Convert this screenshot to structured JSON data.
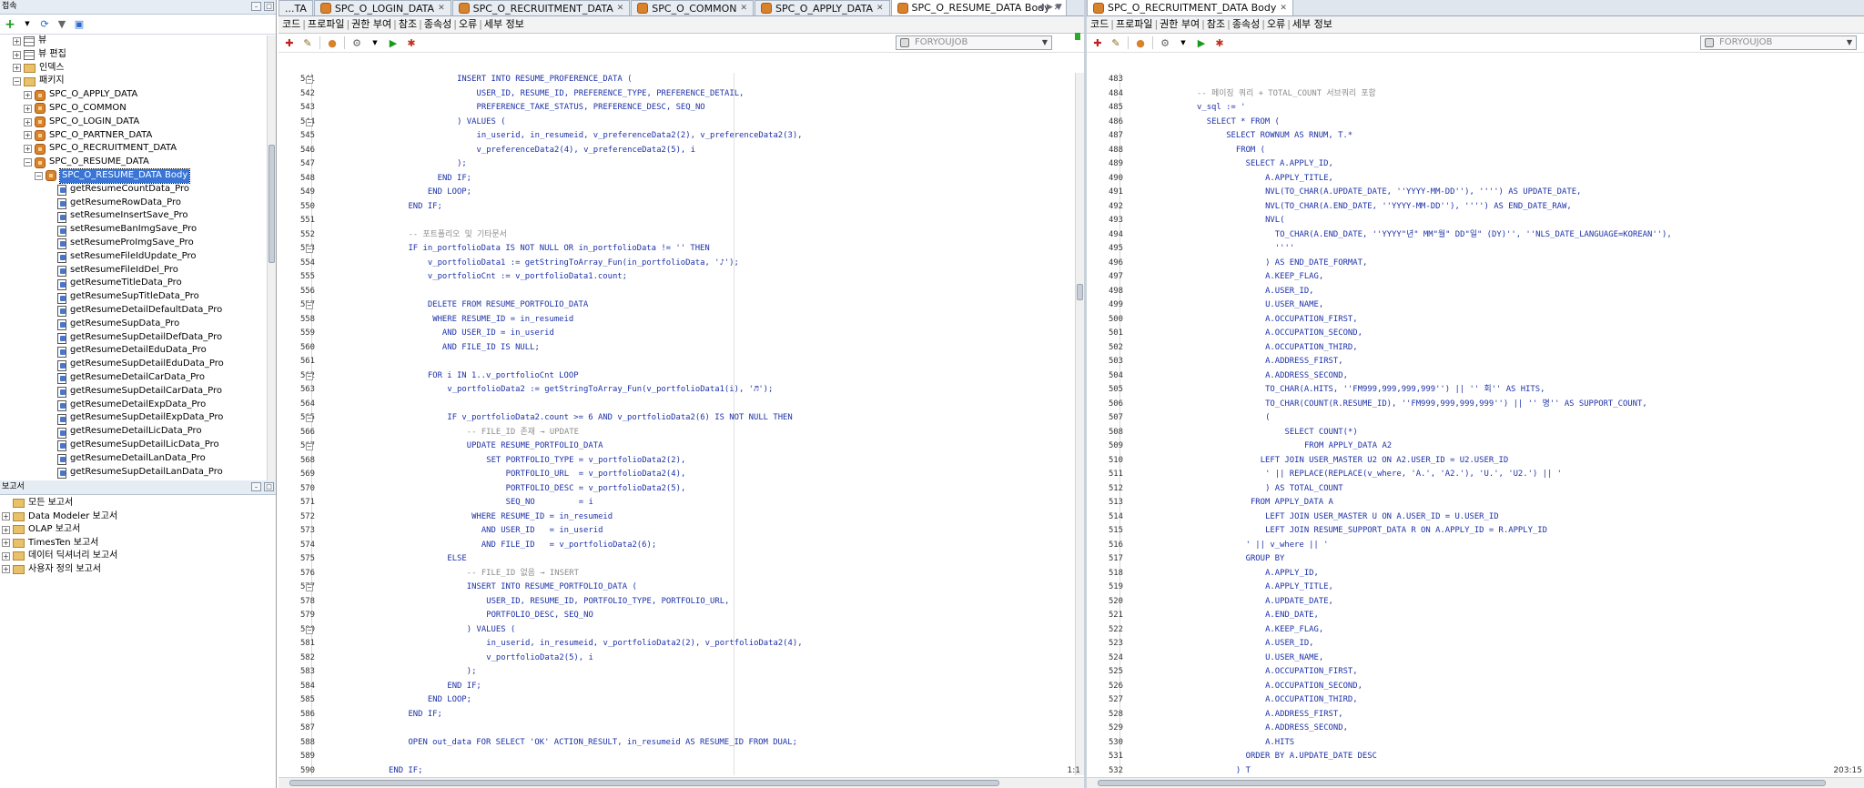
{
  "navigator": {
    "title": "접속",
    "tree": [
      {
        "label": "뷰",
        "kind": "grid",
        "indent": 1,
        "expander": "+"
      },
      {
        "label": "뷰 편집",
        "kind": "grid",
        "indent": 1,
        "expander": "+"
      },
      {
        "label": "인덱스",
        "kind": "folder",
        "indent": 1,
        "expander": "+"
      },
      {
        "label": "패키지",
        "kind": "folder",
        "indent": 1,
        "expander": "-"
      },
      {
        "label": "SPC_O_APPLY_DATA",
        "kind": "package",
        "indent": 2,
        "expander": "+"
      },
      {
        "label": "SPC_O_COMMON",
        "kind": "package",
        "indent": 2,
        "expander": "+"
      },
      {
        "label": "SPC_O_LOGIN_DATA",
        "kind": "package",
        "indent": 2,
        "expander": "+"
      },
      {
        "label": "SPC_O_PARTNER_DATA",
        "kind": "package",
        "indent": 2,
        "expander": "+"
      },
      {
        "label": "SPC_O_RECRUITMENT_DATA",
        "kind": "package",
        "indent": 2,
        "expander": "+"
      },
      {
        "label": "SPC_O_RESUME_DATA",
        "kind": "package",
        "indent": 2,
        "expander": "-"
      },
      {
        "label": "SPC_O_RESUME_DATA Body",
        "kind": "package",
        "indent": 3,
        "expander": "-",
        "selected": true
      },
      {
        "label": "getResumeCountData_Pro",
        "kind": "proc",
        "indent": 4
      },
      {
        "label": "getResumeRowData_Pro",
        "kind": "proc",
        "indent": 4
      },
      {
        "label": "setResumeInsertSave_Pro",
        "kind": "proc",
        "indent": 4
      },
      {
        "label": "setResumeBanImgSave_Pro",
        "kind": "proc",
        "indent": 4
      },
      {
        "label": "setResumeProImgSave_Pro",
        "kind": "proc",
        "indent": 4
      },
      {
        "label": "setResumeFileIdUpdate_Pro",
        "kind": "proc",
        "indent": 4
      },
      {
        "label": "setResumeFileIdDel_Pro",
        "kind": "proc",
        "indent": 4
      },
      {
        "label": "getResumeTitleData_Pro",
        "kind": "proc",
        "indent": 4
      },
      {
        "label": "getResumeSupTitleData_Pro",
        "kind": "proc",
        "indent": 4
      },
      {
        "label": "getResumeDetailDefaultData_Pro",
        "kind": "proc",
        "indent": 4
      },
      {
        "label": "getResumeSupData_Pro",
        "kind": "proc",
        "indent": 4
      },
      {
        "label": "getResumeSupDetailDefData_Pro",
        "kind": "proc",
        "indent": 4
      },
      {
        "label": "getResumeDetailEduData_Pro",
        "kind": "proc",
        "indent": 4
      },
      {
        "label": "getResumeSupDetailEduData_Pro",
        "kind": "proc",
        "indent": 4
      },
      {
        "label": "getResumeDetailCarData_Pro",
        "kind": "proc",
        "indent": 4
      },
      {
        "label": "getResumeSupDetailCarData_Pro",
        "kind": "proc",
        "indent": 4
      },
      {
        "label": "getResumeDetailExpData_Pro",
        "kind": "proc",
        "indent": 4
      },
      {
        "label": "getResumeSupDetailExpData_Pro",
        "kind": "proc",
        "indent": 4
      },
      {
        "label": "getResumeDetailLicData_Pro",
        "kind": "proc",
        "indent": 4
      },
      {
        "label": "getResumeSupDetailLicData_Pro",
        "kind": "proc",
        "indent": 4
      },
      {
        "label": "getResumeDetailLanData_Pro",
        "kind": "proc",
        "indent": 4
      },
      {
        "label": "getResumeSupDetailLanData_Pro",
        "kind": "proc",
        "indent": 4
      }
    ]
  },
  "reports": {
    "title": "보고서",
    "items": [
      {
        "label": "모든 보고서",
        "expander": ""
      },
      {
        "label": "Data Modeler 보고서",
        "expander": "+"
      },
      {
        "label": "OLAP 보고서",
        "expander": "+"
      },
      {
        "label": "TimesTen 보고서",
        "expander": "+"
      },
      {
        "label": "데이터 딕셔너리 보고서",
        "expander": "+"
      },
      {
        "label": "사용자 정의 보고서",
        "expander": "+"
      }
    ]
  },
  "left_tabs": [
    {
      "label": "...TA",
      "active": false
    },
    {
      "label": "SPC_O_LOGIN_DATA",
      "active": false
    },
    {
      "label": "SPC_O_RECRUITMENT_DATA",
      "active": false
    },
    {
      "label": "SPC_O_COMMON",
      "active": false
    },
    {
      "label": "SPC_O_APPLY_DATA",
      "active": false
    },
    {
      "label": "SPC_O_RESUME_DATA Body",
      "active": true
    }
  ],
  "right_tabs": [
    {
      "label": "SPC_O_RECRUITMENT_DATA Body",
      "active": true
    }
  ],
  "subtabs": [
    "코드",
    "프로파일",
    "권한 부여",
    "참조",
    "종속성",
    "오류",
    "세부 정보"
  ],
  "connection": "FORYOUJOB",
  "left_editor": {
    "status": "1:1",
    "lines": [
      {
        "n": "541",
        "i": 14,
        "t": "INSERT INTO RESUME_PROFERENCE_DATA (",
        "f": "-"
      },
      {
        "n": "542",
        "i": 16,
        "t": "USER_ID, RESUME_ID, PREFERENCE_TYPE, PREFERENCE_DETAIL,"
      },
      {
        "n": "543",
        "i": 16,
        "t": "PREFERENCE_TAKE_STATUS, PREFERENCE_DESC, SEQ_NO"
      },
      {
        "n": "544",
        "i": 14,
        "t": ") VALUES (",
        "f": "-"
      },
      {
        "n": "545",
        "i": 16,
        "t": "in_userid, in_resumeid, v_preferenceData2(2), v_preferenceData2(3),"
      },
      {
        "n": "546",
        "i": 16,
        "t": "v_preferenceData2(4), v_preferenceData2(5), i"
      },
      {
        "n": "547",
        "i": 14,
        "t": ");"
      },
      {
        "n": "548",
        "i": 12,
        "t": "END IF;"
      },
      {
        "n": "549",
        "i": 11,
        "t": "END LOOP;"
      },
      {
        "n": "550",
        "i": 9,
        "t": "END IF;"
      },
      {
        "n": "551",
        "i": 0,
        "t": ""
      },
      {
        "n": "552",
        "i": 9,
        "t": "-- 포트폴리오 및 기타문서",
        "c": true
      },
      {
        "n": "553",
        "i": 9,
        "t": "IF in_portfolioData IS NOT NULL OR in_portfolioData != '' THEN",
        "f": "-"
      },
      {
        "n": "554",
        "i": 11,
        "t": "v_portfolioData1 := getStringToArray_Fun(in_portfolioData, '♪');"
      },
      {
        "n": "555",
        "i": 11,
        "t": "v_portfolioCnt := v_portfolioData1.count;"
      },
      {
        "n": "556",
        "i": 0,
        "t": ""
      },
      {
        "n": "557",
        "i": 11,
        "t": "DELETE FROM RESUME_PORTFOLIO_DATA",
        "f": "-"
      },
      {
        "n": "558",
        "i": 11,
        "t": " WHERE RESUME_ID = in_resumeid"
      },
      {
        "n": "559",
        "i": 11,
        "t": "   AND USER_ID = in_userid"
      },
      {
        "n": "560",
        "i": 11,
        "t": "   AND FILE_ID IS NULL;"
      },
      {
        "n": "561",
        "i": 0,
        "t": ""
      },
      {
        "n": "562",
        "i": 11,
        "t": "FOR i IN 1..v_portfolioCnt LOOP",
        "f": "-"
      },
      {
        "n": "563",
        "i": 13,
        "t": "v_portfolioData2 := getStringToArray_Fun(v_portfolioData1(i), '♬');"
      },
      {
        "n": "564",
        "i": 0,
        "t": ""
      },
      {
        "n": "565",
        "i": 13,
        "t": "IF v_portfolioData2.count >= 6 AND v_portfolioData2(6) IS NOT NULL THEN",
        "f": "-"
      },
      {
        "n": "566",
        "i": 15,
        "t": "-- FILE_ID 존재 → UPDATE",
        "c": true
      },
      {
        "n": "567",
        "i": 15,
        "t": "UPDATE RESUME_PORTFOLIO_DATA",
        "f": "-"
      },
      {
        "n": "568",
        "i": 17,
        "t": "SET PORTFOLIO_TYPE = v_portfolioData2(2),"
      },
      {
        "n": "569",
        "i": 17,
        "t": "    PORTFOLIO_URL  = v_portfolioData2(4),"
      },
      {
        "n": "570",
        "i": 17,
        "t": "    PORTFOLIO_DESC = v_portfolioData2(5),"
      },
      {
        "n": "571",
        "i": 17,
        "t": "    SEQ_NO         = i"
      },
      {
        "n": "572",
        "i": 15,
        "t": " WHERE RESUME_ID = in_resumeid"
      },
      {
        "n": "573",
        "i": 15,
        "t": "   AND USER_ID   = in_userid"
      },
      {
        "n": "574",
        "i": 15,
        "t": "   AND FILE_ID   = v_portfolioData2(6);"
      },
      {
        "n": "575",
        "i": 13,
        "t": "ELSE"
      },
      {
        "n": "576",
        "i": 15,
        "t": "-- FILE_ID 없음 → INSERT",
        "c": true
      },
      {
        "n": "577",
        "i": 15,
        "t": "INSERT INTO RESUME_PORTFOLIO_DATA (",
        "f": "-"
      },
      {
        "n": "578",
        "i": 17,
        "t": "USER_ID, RESUME_ID, PORTFOLIO_TYPE, PORTFOLIO_URL,"
      },
      {
        "n": "579",
        "i": 17,
        "t": "PORTFOLIO_DESC, SEQ_NO"
      },
      {
        "n": "580",
        "i": 15,
        "t": ") VALUES (",
        "f": "-"
      },
      {
        "n": "581",
        "i": 17,
        "t": "in_userid, in_resumeid, v_portfolioData2(2), v_portfolioData2(4),"
      },
      {
        "n": "582",
        "i": 17,
        "t": "v_portfolioData2(5), i"
      },
      {
        "n": "583",
        "i": 15,
        "t": ");"
      },
      {
        "n": "584",
        "i": 13,
        "t": "END IF;"
      },
      {
        "n": "585",
        "i": 11,
        "t": "END LOOP;"
      },
      {
        "n": "586",
        "i": 9,
        "t": "END IF;"
      },
      {
        "n": "587",
        "i": 0,
        "t": ""
      },
      {
        "n": "588",
        "i": 9,
        "t": "OPEN out_data FOR SELECT 'OK' ACTION_RESULT, in_resumeid AS RESUME_ID FROM DUAL;"
      },
      {
        "n": "589",
        "i": 0,
        "t": ""
      },
      {
        "n": "590",
        "i": 7,
        "t": "END IF;"
      }
    ]
  },
  "right_editor": {
    "status": "203:15",
    "lines": [
      {
        "n": "483",
        "i": 0,
        "t": ""
      },
      {
        "n": "484",
        "i": 7,
        "t": "-- 페이징 쿼리 + TOTAL_COUNT 서브쿼리 포함",
        "c": true
      },
      {
        "n": "485",
        "i": 7,
        "t": "v_sql := '"
      },
      {
        "n": "486",
        "i": 8,
        "t": "SELECT * FROM ("
      },
      {
        "n": "487",
        "i": 10,
        "t": "SELECT ROWNUM AS RNUM, T.*"
      },
      {
        "n": "488",
        "i": 11,
        "t": "FROM ("
      },
      {
        "n": "489",
        "i": 12,
        "t": "SELECT A.APPLY_ID,"
      },
      {
        "n": "490",
        "i": 14,
        "t": "A.APPLY_TITLE,"
      },
      {
        "n": "491",
        "i": 14,
        "t": "NVL(TO_CHAR(A.UPDATE_DATE, ''YYYY-MM-DD''), '''') AS UPDATE_DATE,"
      },
      {
        "n": "492",
        "i": 14,
        "t": "NVL(TO_CHAR(A.END_DATE, ''YYYY-MM-DD''), '''') AS END_DATE_RAW,"
      },
      {
        "n": "493",
        "i": 14,
        "t": "NVL("
      },
      {
        "n": "494",
        "i": 15,
        "t": "TO_CHAR(A.END_DATE, ''YYYY\"년\" MM\"월\" DD\"일\" (DY)'', ''NLS_DATE_LANGUAGE=KOREAN''),"
      },
      {
        "n": "495",
        "i": 15,
        "t": "''''"
      },
      {
        "n": "496",
        "i": 14,
        "t": ") AS END_DATE_FORMAT,"
      },
      {
        "n": "497",
        "i": 14,
        "t": "A.KEEP_FLAG,"
      },
      {
        "n": "498",
        "i": 14,
        "t": "A.USER_ID,"
      },
      {
        "n": "499",
        "i": 14,
        "t": "U.USER_NAME,"
      },
      {
        "n": "500",
        "i": 14,
        "t": "A.OCCUPATION_FIRST,"
      },
      {
        "n": "501",
        "i": 14,
        "t": "A.OCCUPATION_SECOND,"
      },
      {
        "n": "502",
        "i": 14,
        "t": "A.OCCUPATION_THIRD,"
      },
      {
        "n": "503",
        "i": 14,
        "t": "A.ADDRESS_FIRST,"
      },
      {
        "n": "504",
        "i": 14,
        "t": "A.ADDRESS_SECOND,"
      },
      {
        "n": "505",
        "i": 14,
        "t": "TO_CHAR(A.HITS, ''FM999,999,999,999'') || '' 회'' AS HITS,"
      },
      {
        "n": "506",
        "i": 14,
        "t": "TO_CHAR(COUNT(R.RESUME_ID), ''FM999,999,999,999'') || '' 명'' AS SUPPORT_COUNT,"
      },
      {
        "n": "507",
        "i": 14,
        "t": "("
      },
      {
        "n": "508",
        "i": 16,
        "t": "SELECT COUNT(*)"
      },
      {
        "n": "509",
        "i": 18,
        "t": "FROM APPLY_DATA A2"
      },
      {
        "n": "510",
        "i": 13,
        "t": " LEFT JOIN USER_MASTER U2 ON A2.USER_ID = U2.USER_ID"
      },
      {
        "n": "511",
        "i": 14,
        "t": "' || REPLACE(REPLACE(v_where, 'A.', 'A2.'), 'U.', 'U2.') || '"
      },
      {
        "n": "512",
        "i": 14,
        "t": ") AS TOTAL_COUNT"
      },
      {
        "n": "513",
        "i": 12,
        "t": " FROM APPLY_DATA A"
      },
      {
        "n": "514",
        "i": 14,
        "t": "LEFT JOIN USER_MASTER U ON A.USER_ID = U.USER_ID"
      },
      {
        "n": "515",
        "i": 14,
        "t": "LEFT JOIN RESUME_SUPPORT_DATA R ON A.APPLY_ID = R.APPLY_ID"
      },
      {
        "n": "516",
        "i": 12,
        "t": "' || v_where || '"
      },
      {
        "n": "517",
        "i": 12,
        "t": "GROUP BY"
      },
      {
        "n": "518",
        "i": 14,
        "t": "A.APPLY_ID,"
      },
      {
        "n": "519",
        "i": 14,
        "t": "A.APPLY_TITLE,"
      },
      {
        "n": "520",
        "i": 14,
        "t": "A.UPDATE_DATE,"
      },
      {
        "n": "521",
        "i": 14,
        "t": "A.END_DATE,"
      },
      {
        "n": "522",
        "i": 14,
        "t": "A.KEEP_FLAG,"
      },
      {
        "n": "523",
        "i": 14,
        "t": "A.USER_ID,"
      },
      {
        "n": "524",
        "i": 14,
        "t": "U.USER_NAME,"
      },
      {
        "n": "525",
        "i": 14,
        "t": "A.OCCUPATION_FIRST,"
      },
      {
        "n": "526",
        "i": 14,
        "t": "A.OCCUPATION_SECOND,"
      },
      {
        "n": "527",
        "i": 14,
        "t": "A.OCCUPATION_THIRD,"
      },
      {
        "n": "528",
        "i": 14,
        "t": "A.ADDRESS_FIRST,"
      },
      {
        "n": "529",
        "i": 14,
        "t": "A.ADDRESS_SECOND,"
      },
      {
        "n": "530",
        "i": 14,
        "t": "A.HITS"
      },
      {
        "n": "531",
        "i": 12,
        "t": "ORDER BY A.UPDATE_DATE DESC"
      },
      {
        "n": "532",
        "i": 11,
        "t": ") T"
      }
    ]
  }
}
